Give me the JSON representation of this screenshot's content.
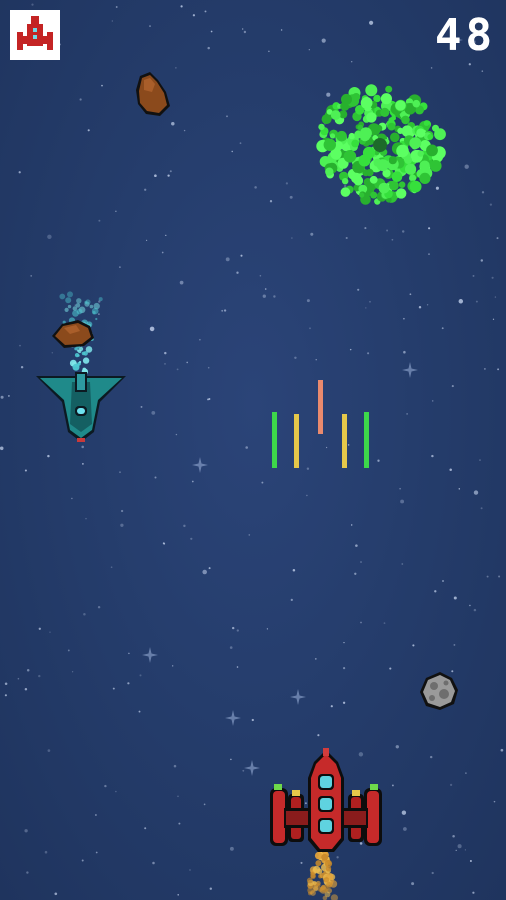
{
  "hud": {
    "score": "48",
    "lives_icon": "red-ship-life-icon"
  },
  "colors": {
    "space_background": "#253d6c",
    "player_ship": "#c62a2a",
    "player_windows": "#5fd3e0",
    "enemy_ship": "#1f8a8a",
    "green_burst": "#36e03c",
    "laser_green": "#3dd84a",
    "laser_yellow": "#e6c84a",
    "laser_red": "#e98a6e",
    "asteroid_brown": "#8b4a1c",
    "asteroid_grey": "#9a9a9a"
  },
  "sprites": {
    "player": "player-ship-icon",
    "enemy": "enemy-ship-icon",
    "explosion": "green-burst-icon",
    "asteroids": [
      "brown-asteroid-icon",
      "brown-asteroid-icon",
      "grey-asteroid-icon"
    ],
    "lasers": [
      "green-laser",
      "yellow-laser",
      "red-laser",
      "yellow-laser",
      "green-laser"
    ]
  }
}
